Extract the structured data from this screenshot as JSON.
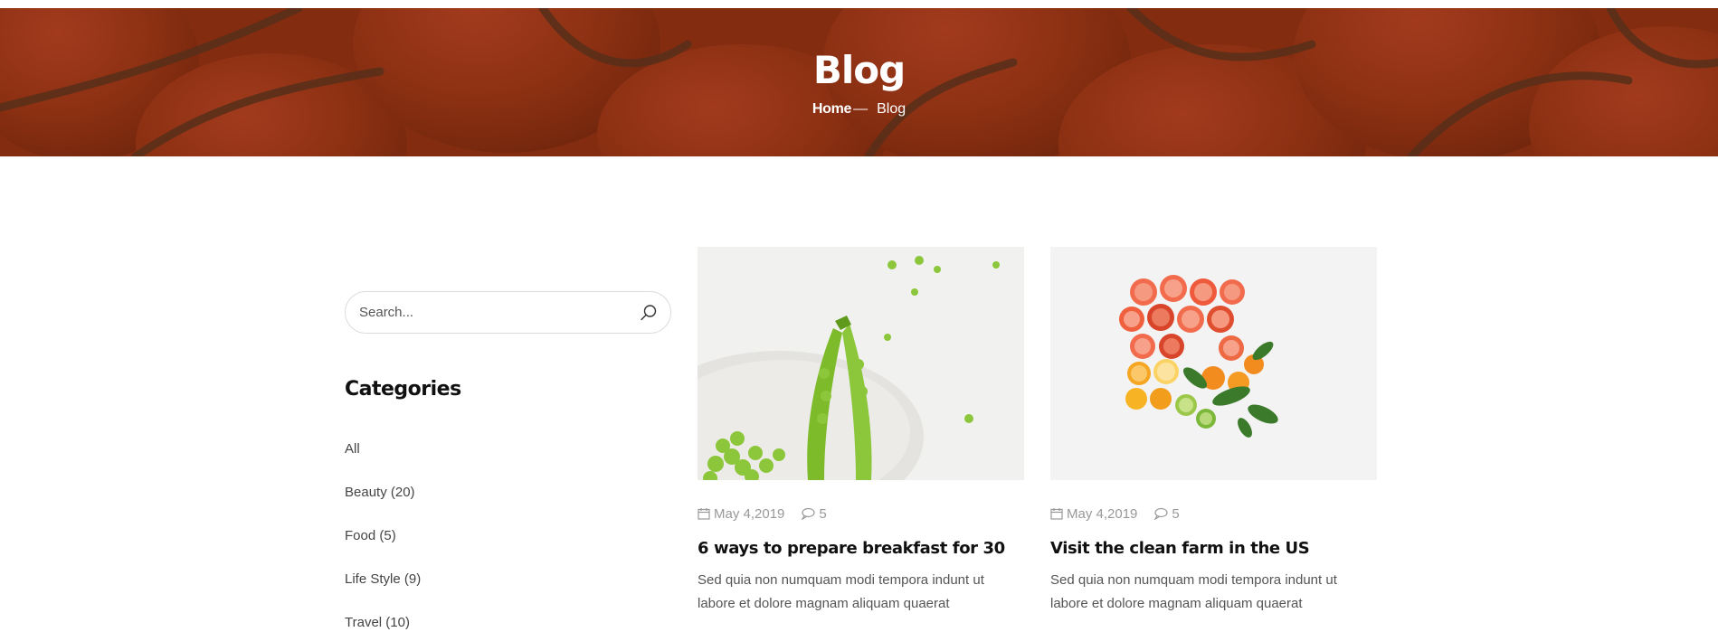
{
  "hero": {
    "title": "Blog",
    "breadcrumb_home": "Home",
    "breadcrumb_separator": "—",
    "breadcrumb_current": "Blog"
  },
  "sidebar": {
    "search": {
      "placeholder": "Search..."
    },
    "categories_title": "Categories",
    "categories": [
      {
        "label": "All"
      },
      {
        "label": "Beauty (20)"
      },
      {
        "label": "Food (5)"
      },
      {
        "label": "Life Style (9)"
      },
      {
        "label": "Travel (10)"
      }
    ]
  },
  "posts": [
    {
      "date": "May 4,2019",
      "comments": "5",
      "title": "6 ways to prepare breakfast for 30",
      "excerpt": "Sed quia non numquam modi tempora indunt ut labore et dolore magnam aliquam quaerat"
    },
    {
      "date": "May 4,2019",
      "comments": "5",
      "title": "Visit the clean farm in the US",
      "excerpt": "Sed quia non numquam modi tempora indunt ut labore et dolore magnam aliquam quaerat"
    }
  ],
  "colors": {
    "hero_overlay": "#7a2a10",
    "accent_text": "#111111",
    "muted_text": "#999999"
  }
}
